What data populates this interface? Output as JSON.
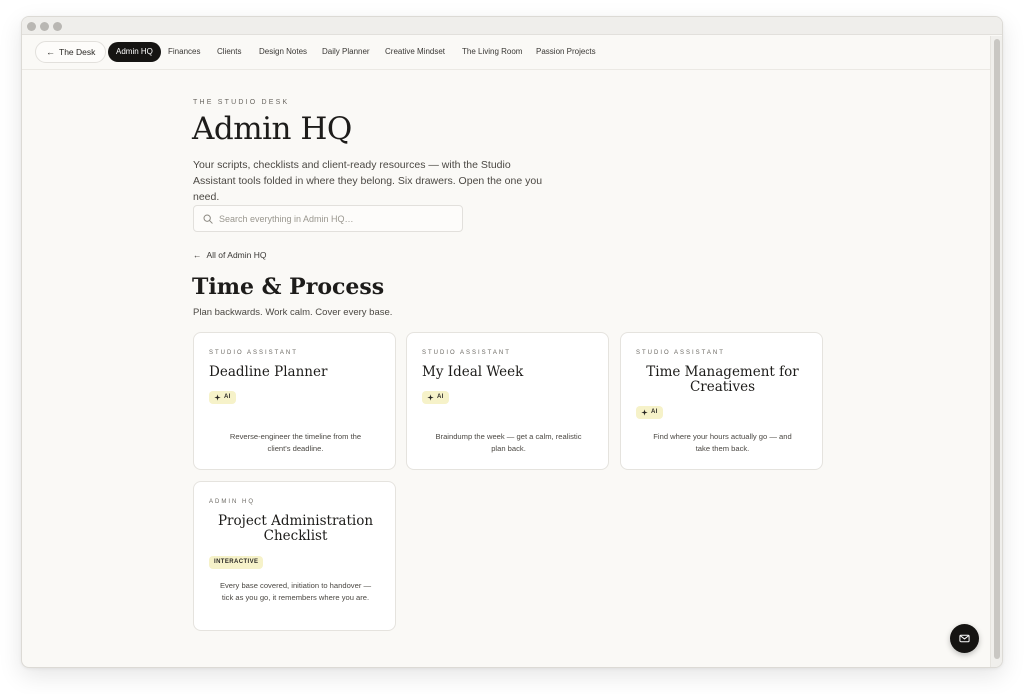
{
  "nav": {
    "back_label": "The Desk",
    "tabs": [
      {
        "label": "Admin HQ",
        "active": true
      },
      {
        "label": "Finances"
      },
      {
        "label": "Clients"
      },
      {
        "label": "Design Notes"
      },
      {
        "label": "Daily Planner"
      },
      {
        "label": "Creative Mindset"
      },
      {
        "label": "The Living Room"
      },
      {
        "label": "Passion Projects"
      }
    ]
  },
  "header": {
    "eyebrow": "THE STUDIO DESK",
    "title": "Admin HQ",
    "intro": "Your scripts, checklists and client-ready resources — with the Studio Assistant tools folded in where they belong. Six drawers. Open the one you need."
  },
  "search": {
    "placeholder": "Search everything in Admin HQ…",
    "value": ""
  },
  "section": {
    "back_link": "All of Admin HQ",
    "title": "Time & Process",
    "subtitle": "Plan backwards. Work calm. Cover every base."
  },
  "cards": [
    {
      "kicker": "STUDIO ASSISTANT",
      "title": "Deadline Planner",
      "badge": "AI",
      "desc": "Reverse-engineer the timeline from the client's deadline."
    },
    {
      "kicker": "STUDIO ASSISTANT",
      "title": "My Ideal Week",
      "badge": "AI",
      "desc": "Braindump the week — get a calm, realistic plan back."
    },
    {
      "kicker": "STUDIO ASSISTANT",
      "title": "Time Management for Creatives",
      "badge": "AI",
      "desc": "Find where your hours actually go — and take them back."
    },
    {
      "kicker": "ADMIN HQ",
      "title": "Project Administration Checklist",
      "badge": "INTERACTIVE",
      "desc": "Every base covered, initiation to handover — tick as you go, it remembers where you are."
    }
  ],
  "icons": {
    "back": "arrow-left-icon",
    "search": "search-icon",
    "ai": "sparkle-icon",
    "fab": "mail-icon"
  },
  "colors": {
    "background": "#faf9f6",
    "active_tab": "#151412",
    "badge": "#f6f2c9"
  }
}
